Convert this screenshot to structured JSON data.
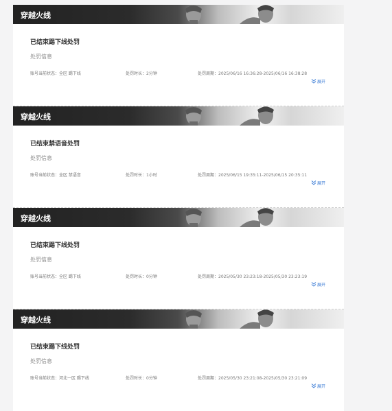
{
  "records": [
    {
      "game": "穿越火线",
      "title": "已结束踢下线处罚",
      "info_label": "处罚信息",
      "status": "账号当前状态：全区 踢下线",
      "duration": "处罚时长：2分钟",
      "period": "处罚周期：2025/06/16 16:36:28-2025/06/16 16:38:28",
      "expand_label": "展开"
    },
    {
      "game": "穿越火线",
      "title": "已结束禁语音处罚",
      "info_label": "处罚信息",
      "status": "账号当前状态：全区 禁语音",
      "duration": "处罚时长：1小时",
      "period": "处罚周期：2025/06/15 19:35:11-2025/06/15 20:35:11",
      "expand_label": "展开"
    },
    {
      "game": "穿越火线",
      "title": "已结束踢下线处罚",
      "info_label": "处罚信息",
      "status": "账号当前状态：全区 踢下线",
      "duration": "处罚时长：0分钟",
      "period": "处罚周期：2025/05/30 23:23:18-2025/05/30 23:23:19",
      "expand_label": "展开"
    },
    {
      "game": "穿越火线",
      "title": "已结束踢下线处罚",
      "info_label": "处罚信息",
      "status": "账号当前状态：河北一区 踢下线",
      "duration": "处罚时长：0分钟",
      "period": "处罚周期：2025/05/30 23:21:08-2025/05/30 23:21:09",
      "expand_label": "展开"
    }
  ],
  "colors": {
    "accent": "#3a7bd5",
    "banner_dark": "#222222",
    "page_bg": "#f4f4f5"
  },
  "icons": {
    "expand": "double-chevron-down-icon"
  }
}
